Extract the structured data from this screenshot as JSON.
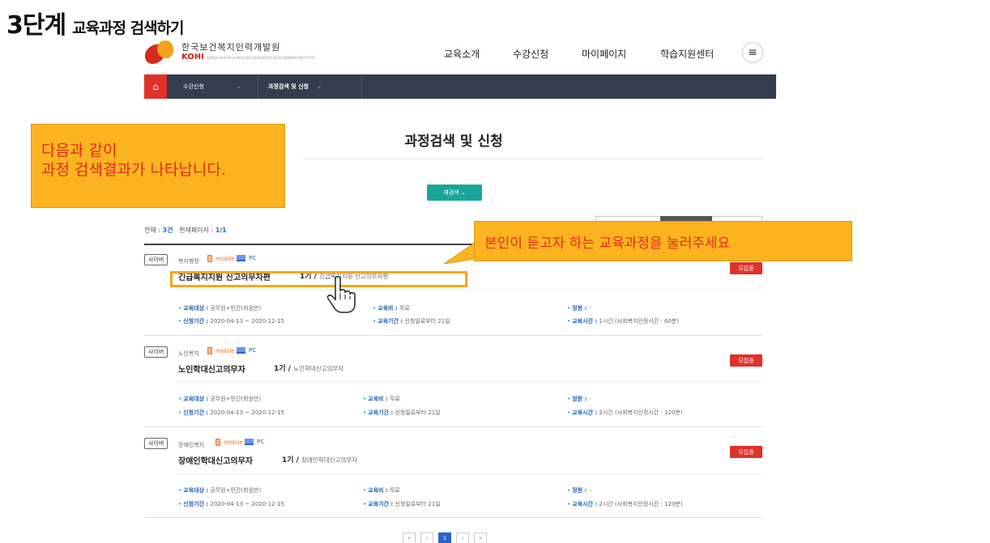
{
  "step_title": {
    "number": "3단계",
    "text": "교육과정 검색하기"
  },
  "header": {
    "logo_ko": "한국보건복지인력개발원",
    "logo_en": "KOHI",
    "logo_en_sub": "KOREA HEALTH & WELFARE RESOURCES DEVELOPMENT INSTITUTE",
    "nav": [
      "교육소개",
      "수강신청",
      "마이페이지",
      "학습지원센터"
    ],
    "menu_icon": "hamburger-icon"
  },
  "subnav": {
    "home_icon": "home-icon",
    "items": [
      "수강신청",
      "과정검색 및 신청"
    ]
  },
  "page_heading": "과정검색 및 신청",
  "research_button": "재검색 ⌄",
  "count": {
    "total_label": "전체 : ",
    "total": "3건",
    "page_label": "현재페이지 : ",
    "page": "1/1"
  },
  "courses": [
    {
      "badge": "사이버",
      "category": "복지행정",
      "mobile": "mobile",
      "pc": "PC",
      "name": "긴급복지지원 신고의무자편",
      "round": "1기 / ",
      "round_desc": "긴급복지지원 신고의무자편",
      "status": "모집중",
      "target_label": "교육대상 :",
      "target": "공무원+민간(회원만)",
      "period_label": "신청기간 :",
      "period": "2020-04-13 ~ 2020-12-15",
      "fee_label": "교육비 :",
      "fee": "무료",
      "duration_label": "교육기간 :",
      "duration": "신청일로부터 21일",
      "capacity_label": "정원 :",
      "capacity": "-",
      "hours_label": "교육시간 :",
      "hours": "1시간 (사회복지안정시간 : 60분)"
    },
    {
      "badge": "사이버",
      "category": "노인복지",
      "mobile": "mobile",
      "pc": "PC",
      "name": "노인학대신고의무자",
      "round": "1기 / ",
      "round_desc": "노인학대신고의무자",
      "status": "모집중",
      "target_label": "교육대상 :",
      "target": "공무원+민간(회원만)",
      "period_label": "신청기간 :",
      "period": "2020-04-13 ~ 2020-12-15",
      "fee_label": "교육비 :",
      "fee": "무료",
      "duration_label": "교육기간 :",
      "duration": "신청일로부터 21일",
      "capacity_label": "정원 :",
      "capacity": "-",
      "hours_label": "교육시간 :",
      "hours": "2시간 (사회복지안정시간 : 120분)"
    },
    {
      "badge": "사이버",
      "category": "장애인복지",
      "mobile": "mobile",
      "pc": "PC",
      "name": "장애인학대신고의무자",
      "round": "1기 / ",
      "round_desc": "장애인학대신고의무자",
      "status": "모집중",
      "target_label": "교육대상 :",
      "target": "공무원+민간(회원만)",
      "period_label": "신청기간 :",
      "period": "2020-04-13 ~ 2020-12-15",
      "fee_label": "교육비 :",
      "fee": "무료",
      "duration_label": "교육기간 :",
      "duration": "신청일로부터 21일",
      "capacity_label": "정원 :",
      "capacity": "-",
      "hours_label": "교육시간 :",
      "hours": "2시간 (사회복지안정시간 : 120분)"
    }
  ],
  "pager": [
    "«",
    "‹",
    "1",
    "›",
    "»"
  ],
  "callouts": {
    "left_line1": "다음과 같이",
    "left_line2": "과정 검색결과가 나타납니다.",
    "right": "본인이 듣고자 하는 교육과정을 눌러주세요"
  },
  "colors": {
    "accent_red": "#e0312a",
    "callout_yellow": "#fbb41f",
    "callout_text": "#e42a1d",
    "nav_dark": "#343d4e",
    "teal": "#1aa59a"
  }
}
